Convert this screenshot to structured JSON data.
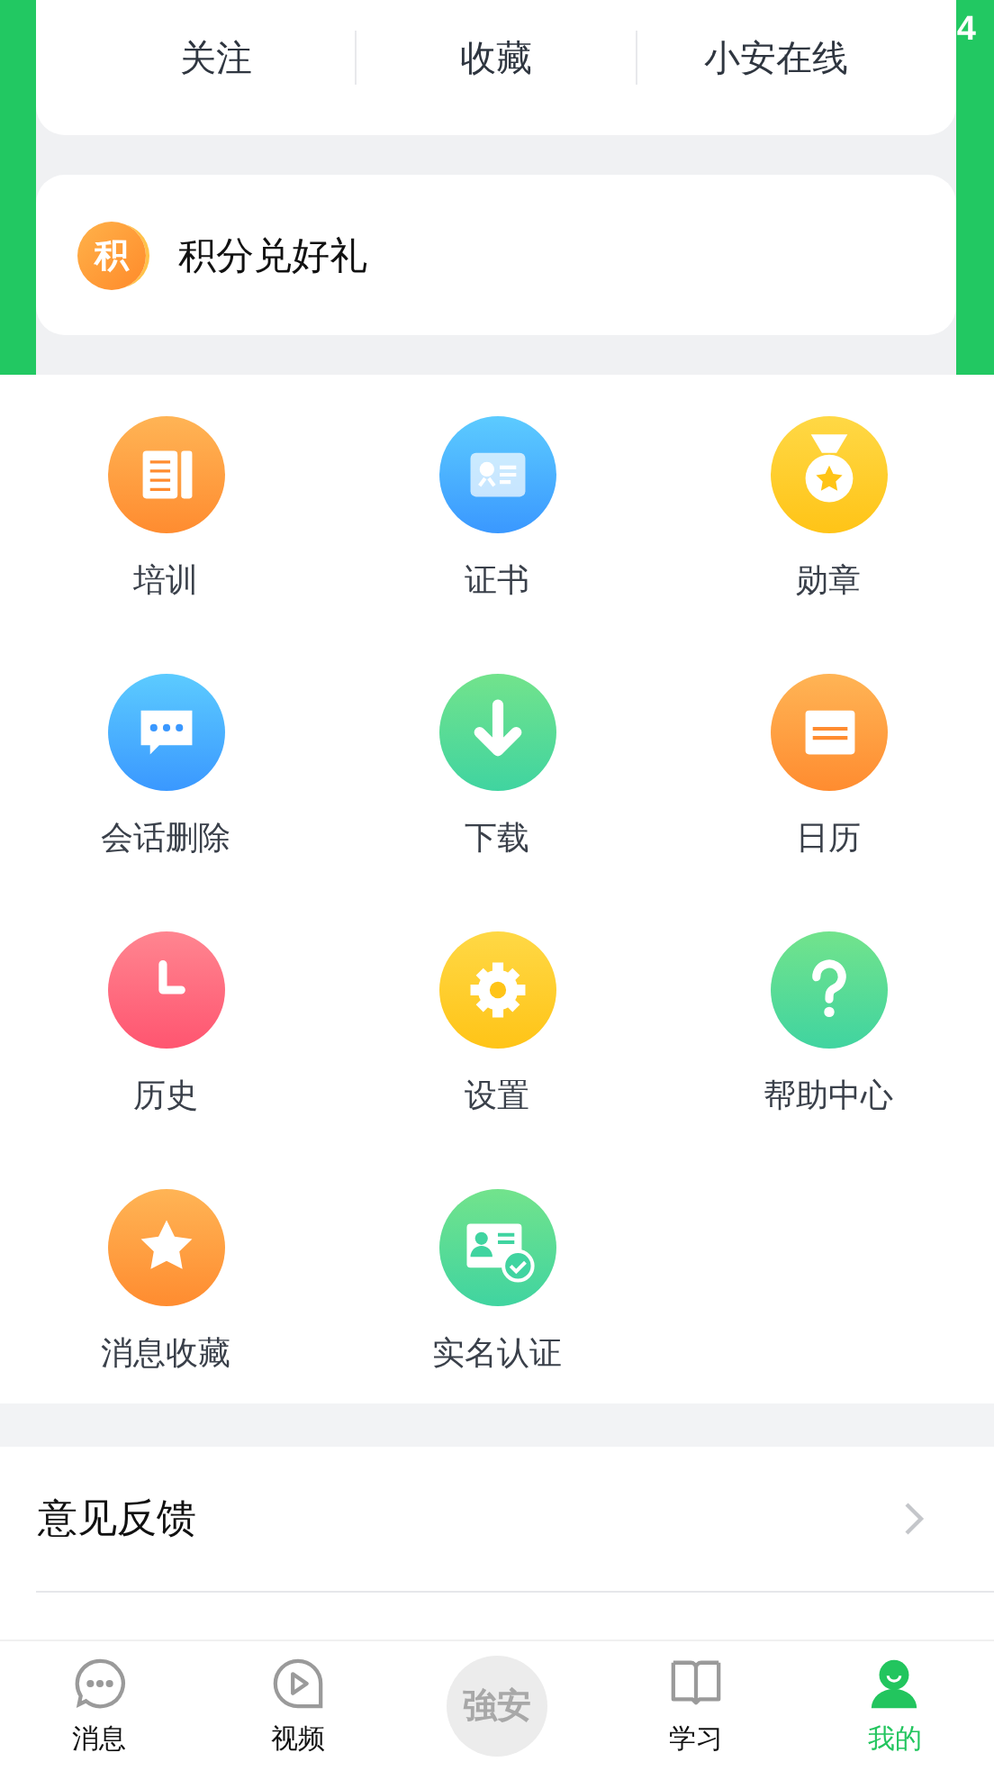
{
  "status_text": "4",
  "top_tabs": [
    {
      "label": "关注"
    },
    {
      "label": "收藏"
    },
    {
      "label": "小安在线"
    }
  ],
  "points_card": {
    "badge": "积",
    "label": "积分兑好礼"
  },
  "grid": [
    {
      "label": "培训"
    },
    {
      "label": "证书"
    },
    {
      "label": "勋章"
    },
    {
      "label": "会话删除"
    },
    {
      "label": "下载"
    },
    {
      "label": "日历"
    },
    {
      "label": "历史"
    },
    {
      "label": "设置"
    },
    {
      "label": "帮助中心"
    },
    {
      "label": "消息收藏"
    },
    {
      "label": "实名认证"
    }
  ],
  "feedback": {
    "label": "意见反馈"
  },
  "bottom_nav": [
    {
      "kind": "tab",
      "label": "消息",
      "selected": false
    },
    {
      "kind": "tab",
      "label": "视频",
      "selected": false
    },
    {
      "kind": "logo",
      "label": "強安"
    },
    {
      "kind": "tab",
      "label": "学习",
      "selected": false
    },
    {
      "kind": "tab",
      "label": "我的",
      "selected": true
    }
  ]
}
